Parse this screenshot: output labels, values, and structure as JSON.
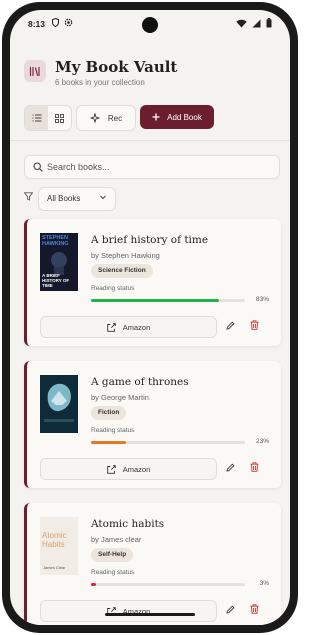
{
  "status_bar": {
    "time": "8:13"
  },
  "header": {
    "title": "My Book Vault",
    "subtitle": "6 books in your collection"
  },
  "toolbar": {
    "rec_label": "Rec",
    "add_label": "Add Book"
  },
  "search": {
    "placeholder": "Search books..."
  },
  "filter": {
    "selected": "All Books"
  },
  "reading_status_label": "Reading status",
  "amazon_label": "Amazon",
  "books": [
    {
      "title": "A brief history of time",
      "author": "by Stephen Hawking",
      "genre": "Science Fiction",
      "progress": 83,
      "progress_label": "83%",
      "color": "#22b24c",
      "cover_text": [
        "STEPHEN",
        "HAWKING",
        "A BRIEF",
        "HISTORY OF",
        "TIME"
      ]
    },
    {
      "title": "A game of thrones",
      "author": "by George Martin",
      "genre": "Fiction",
      "progress": 23,
      "progress_label": "23%",
      "color": "#ea7524",
      "cover_text": []
    },
    {
      "title": "Atomic habits",
      "author": "by James clear",
      "genre": "Self-Help",
      "progress": 3,
      "progress_label": "3%",
      "color": "#e0262b",
      "cover_text": [
        "Atomic",
        "Habits",
        "James Clear"
      ]
    }
  ],
  "colors": {
    "accent": "#6b1e2e",
    "background": "#f5f3ef",
    "card": "#faf9f6"
  }
}
